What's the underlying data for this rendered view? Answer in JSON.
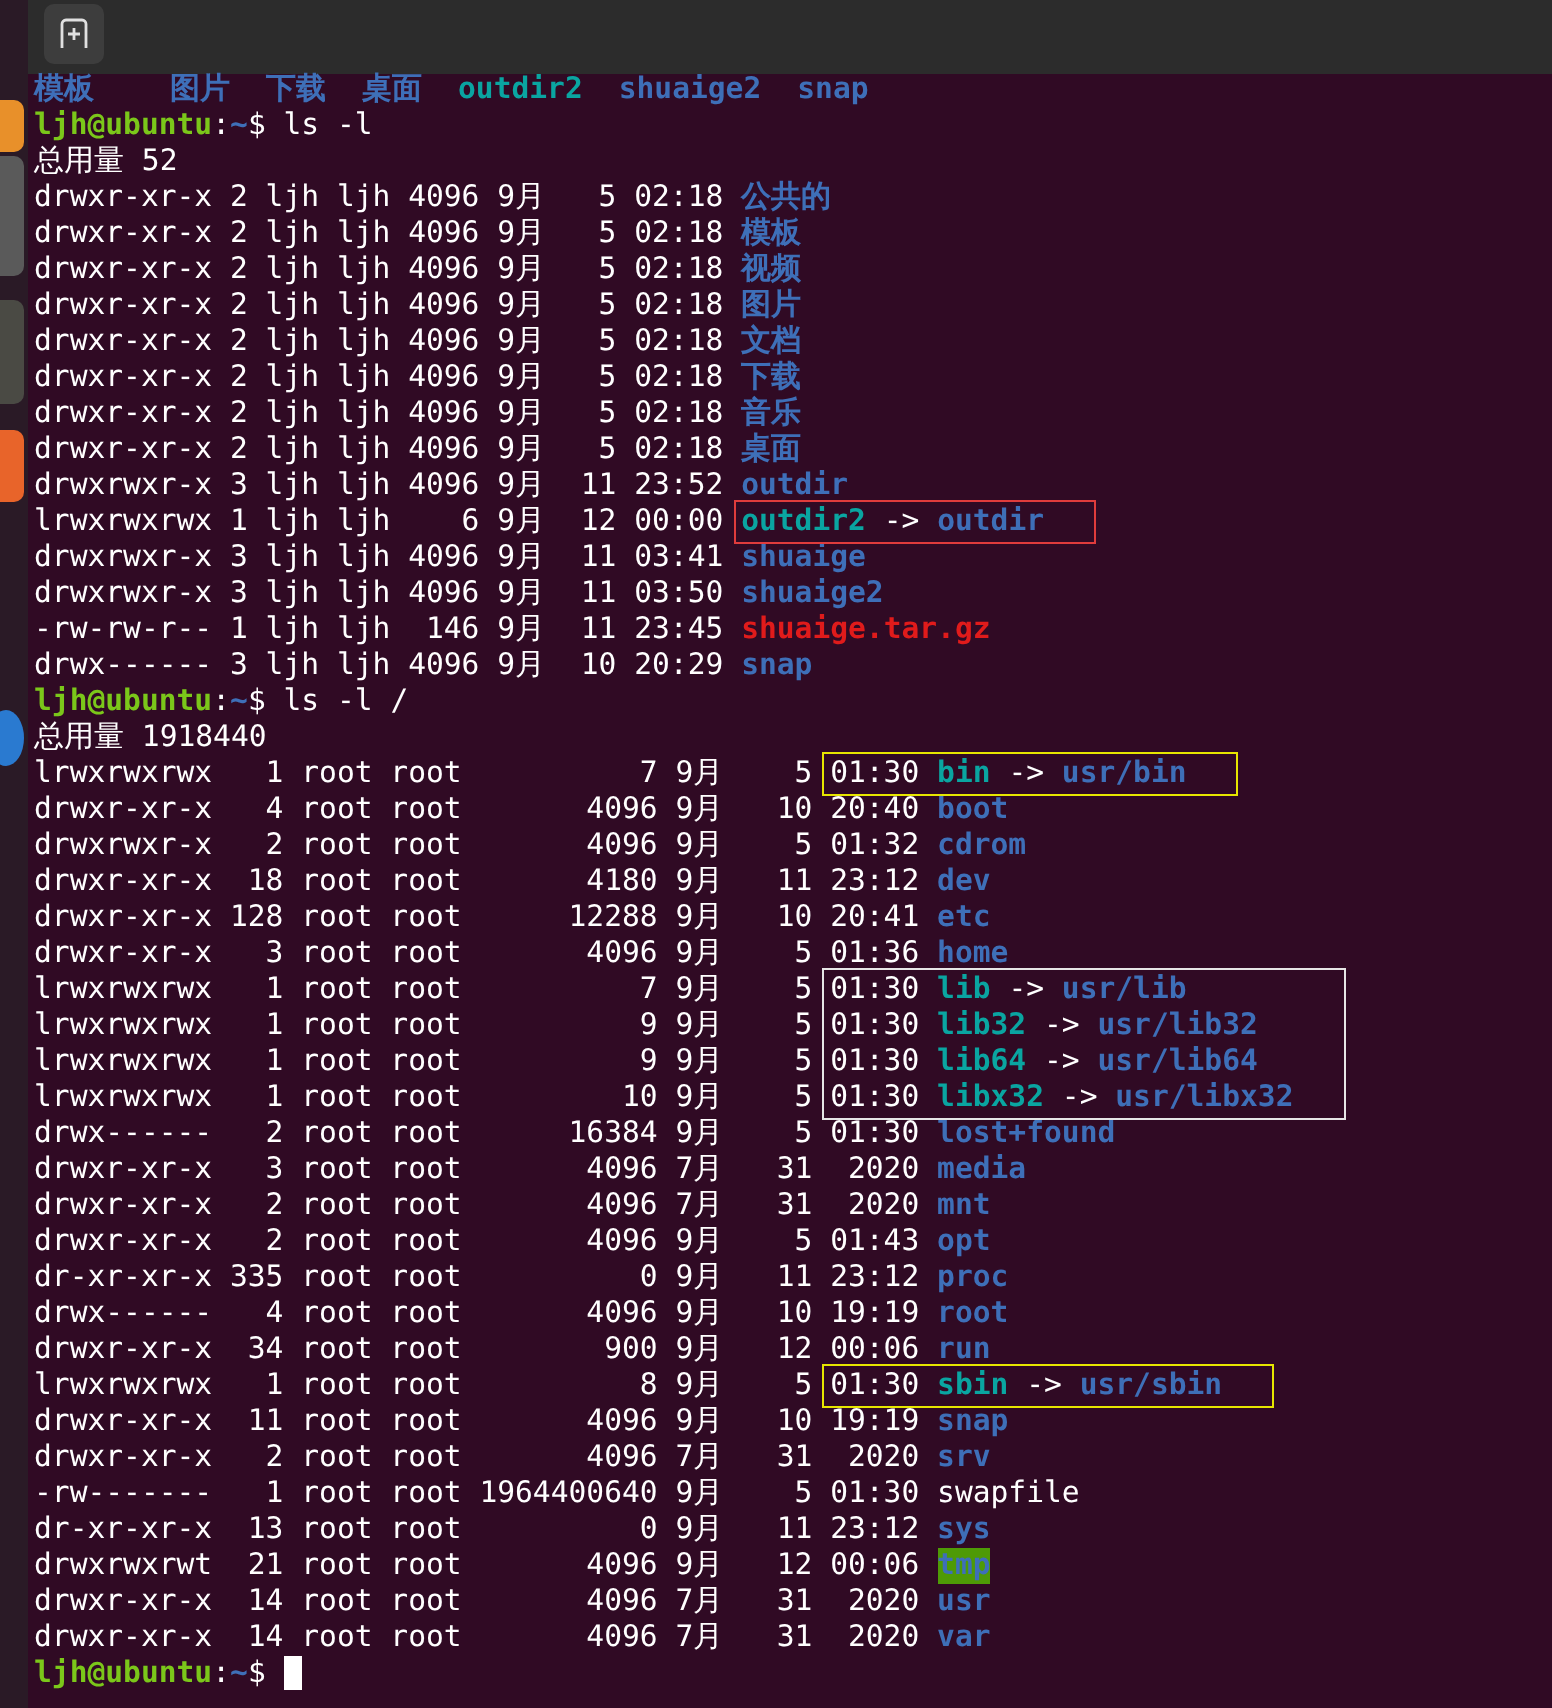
{
  "terminal": {
    "lines": [
      {
        "kind": "names",
        "items": [
          {
            "text": "模板",
            "kind": "dir"
          },
          {
            "text": "图片",
            "kind": "dir"
          },
          {
            "text": "下载",
            "kind": "dir"
          },
          {
            "text": "桌面",
            "kind": "dir"
          },
          {
            "text": "outdir2",
            "kind": "link"
          },
          {
            "text": "shuaige2",
            "kind": "dir"
          },
          {
            "text": "snap",
            "kind": "dir"
          }
        ]
      },
      {
        "kind": "prompt",
        "parts": [
          {
            "text": "ljh@ubuntu",
            "kind": "user"
          },
          {
            "text": ":",
            "kind": "plain"
          },
          {
            "text": "~",
            "kind": "path"
          },
          {
            "text": "$ ls -l",
            "kind": "plain"
          }
        ]
      },
      {
        "kind": "total",
        "text": "总用量 52"
      },
      {
        "kind": "entry",
        "info": "drwxr-xr-x 2 ljh ljh 4096 9月   5",
        "time": "02:18",
        "file": {
          "kind": "dir",
          "name": "公共的"
        }
      },
      {
        "kind": "entry",
        "info": "drwxr-xr-x 2 ljh ljh 4096 9月   5",
        "time": "02:18",
        "file": {
          "kind": "dir",
          "name": "模板"
        }
      },
      {
        "kind": "entry",
        "info": "drwxr-xr-x 2 ljh ljh 4096 9月   5",
        "time": "02:18",
        "file": {
          "kind": "dir",
          "name": "视频"
        }
      },
      {
        "kind": "entry",
        "info": "drwxr-xr-x 2 ljh ljh 4096 9月   5",
        "time": "02:18",
        "file": {
          "kind": "dir",
          "name": "图片"
        }
      },
      {
        "kind": "entry",
        "info": "drwxr-xr-x 2 ljh ljh 4096 9月   5",
        "time": "02:18",
        "file": {
          "kind": "dir",
          "name": "文档"
        }
      },
      {
        "kind": "entry",
        "info": "drwxr-xr-x 2 ljh ljh 4096 9月   5",
        "time": "02:18",
        "file": {
          "kind": "dir",
          "name": "下载"
        }
      },
      {
        "kind": "entry",
        "info": "drwxr-xr-x 2 ljh ljh 4096 9月   5",
        "time": "02:18",
        "file": {
          "kind": "dir",
          "name": "音乐"
        }
      },
      {
        "kind": "entry",
        "info": "drwxr-xr-x 2 ljh ljh 4096 9月   5",
        "time": "02:18",
        "file": {
          "kind": "dir",
          "name": "桌面"
        }
      },
      {
        "kind": "entry",
        "info": "drwxrwxr-x 3 ljh ljh 4096 9月  11",
        "time": "23:52",
        "file": {
          "kind": "dir",
          "name": "outdir"
        }
      },
      {
        "kind": "entry",
        "info": "lrwxrwxrwx 1 ljh ljh    6 9月  12",
        "time": "00:00",
        "file": {
          "kind": "link",
          "name": "outdir2",
          "arrow": "->",
          "target": "outdir"
        },
        "box": {
          "kind": "name",
          "color": "#e03c3c"
        }
      },
      {
        "kind": "entry",
        "info": "drwxrwxr-x 3 ljh ljh 4096 9月  11",
        "time": "03:41",
        "file": {
          "kind": "dir",
          "name": "shuaige"
        }
      },
      {
        "kind": "entry",
        "info": "drwxrwxr-x 3 ljh ljh 4096 9月  11",
        "time": "03:50",
        "file": {
          "kind": "dir",
          "name": "shuaige2"
        }
      },
      {
        "kind": "entry",
        "info": "-rw-rw-r-- 1 ljh ljh  146 9月  11",
        "time": "23:45",
        "file": {
          "kind": "archive",
          "name": "shuaige.tar.gz"
        }
      },
      {
        "kind": "entry",
        "info": "drwx------ 3 ljh ljh 4096 9月  10",
        "time": "20:29",
        "file": {
          "kind": "dir",
          "name": "snap"
        }
      },
      {
        "kind": "prompt",
        "parts": [
          {
            "text": "ljh@ubuntu",
            "kind": "user"
          },
          {
            "text": ":",
            "kind": "plain"
          },
          {
            "text": "~",
            "kind": "path"
          },
          {
            "text": "$ ls -l /",
            "kind": "plain"
          }
        ]
      },
      {
        "kind": "total",
        "text": "总用量 1918440"
      },
      {
        "kind": "entry",
        "info": "lrwxrwxrwx   1 root root          7 9月    5",
        "time": "01:30",
        "file": {
          "kind": "link",
          "name": "bin",
          "arrow": "->",
          "target": "usr/bin"
        },
        "box": {
          "kind": "time",
          "color": "#e6e600"
        }
      },
      {
        "kind": "entry",
        "info": "drwxr-xr-x   4 root root       4096 9月   10",
        "time": "20:40",
        "file": {
          "kind": "dir",
          "name": "boot"
        }
      },
      {
        "kind": "entry",
        "info": "drwxrwxr-x   2 root root       4096 9月    5",
        "time": "01:32",
        "file": {
          "kind": "dir",
          "name": "cdrom"
        }
      },
      {
        "kind": "entry",
        "info": "drwxr-xr-x  18 root root       4180 9月   11",
        "time": "23:12",
        "file": {
          "kind": "dir",
          "name": "dev"
        }
      },
      {
        "kind": "entry",
        "info": "drwxr-xr-x 128 root root      12288 9月   10",
        "time": "20:41",
        "file": {
          "kind": "dir",
          "name": "etc"
        }
      },
      {
        "kind": "entry",
        "info": "drwxr-xr-x   3 root root       4096 9月    5",
        "time": "01:36",
        "file": {
          "kind": "dir",
          "name": "home"
        }
      },
      {
        "kind": "entry",
        "info": "lrwxrwxrwx   1 root root          7 9月    5",
        "time": "01:30",
        "file": {
          "kind": "link",
          "name": "lib",
          "arrow": "->",
          "target": "usr/lib"
        },
        "box": {
          "kind": "time",
          "color": "#e6e6e6"
        }
      },
      {
        "kind": "entry",
        "info": "lrwxrwxrwx   1 root root          9 9月    5",
        "time": "01:30",
        "file": {
          "kind": "link",
          "name": "lib32",
          "arrow": "->",
          "target": "usr/lib32"
        },
        "box": {
          "kind": "time",
          "color": "#e6e6e6"
        }
      },
      {
        "kind": "entry",
        "info": "lrwxrwxrwx   1 root root          9 9月    5",
        "time": "01:30",
        "file": {
          "kind": "link",
          "name": "lib64",
          "arrow": "->",
          "target": "usr/lib64"
        },
        "box": {
          "kind": "time",
          "color": "#e6e6e6"
        }
      },
      {
        "kind": "entry",
        "info": "lrwxrwxrwx   1 root root         10 9月    5",
        "time": "01:30",
        "file": {
          "kind": "link",
          "name": "libx32",
          "arrow": "->",
          "target": "usr/libx32"
        },
        "box": {
          "kind": "time",
          "color": "#e6e6e6"
        }
      },
      {
        "kind": "entry",
        "info": "drwx------   2 root root      16384 9月    5",
        "time": "01:30",
        "file": {
          "kind": "dir",
          "name": "lost+found"
        }
      },
      {
        "kind": "entry",
        "info": "drwxr-xr-x   3 root root       4096 7月   31",
        "time": " 2020",
        "file": {
          "kind": "dir",
          "name": "media"
        }
      },
      {
        "kind": "entry",
        "info": "drwxr-xr-x   2 root root       4096 7月   31",
        "time": " 2020",
        "file": {
          "kind": "dir",
          "name": "mnt"
        }
      },
      {
        "kind": "entry",
        "info": "drwxr-xr-x   2 root root       4096 9月    5",
        "time": "01:43",
        "file": {
          "kind": "dir",
          "name": "opt"
        }
      },
      {
        "kind": "entry",
        "info": "dr-xr-xr-x 335 root root          0 9月   11",
        "time": "23:12",
        "file": {
          "kind": "dir",
          "name": "proc"
        }
      },
      {
        "kind": "entry",
        "info": "drwx------   4 root root       4096 9月   10",
        "time": "19:19",
        "file": {
          "kind": "dir",
          "name": "root"
        }
      },
      {
        "kind": "entry",
        "info": "drwxr-xr-x  34 root root        900 9月   12",
        "time": "00:06",
        "file": {
          "kind": "dir",
          "name": "run"
        }
      },
      {
        "kind": "entry",
        "info": "lrwxrwxrwx   1 root root          8 9月    5",
        "time": "01:30",
        "file": {
          "kind": "link",
          "name": "sbin",
          "arrow": "->",
          "target": "usr/sbin"
        },
        "box": {
          "kind": "time",
          "color": "#e6e600"
        }
      },
      {
        "kind": "entry",
        "info": "drwxr-xr-x  11 root root       4096 9月   10",
        "time": "19:19",
        "file": {
          "kind": "dir",
          "name": "snap"
        }
      },
      {
        "kind": "entry",
        "info": "drwxr-xr-x   2 root root       4096 7月   31",
        "time": " 2020",
        "file": {
          "kind": "dir",
          "name": "srv"
        }
      },
      {
        "kind": "entry",
        "info": "-rw-------   1 root root 1964400640 9月    5",
        "time": "01:30",
        "file": {
          "kind": "file",
          "name": "swapfile"
        }
      },
      {
        "kind": "entry",
        "info": "dr-xr-xr-x  13 root root          0 9月   11",
        "time": "23:12",
        "file": {
          "kind": "dir",
          "name": "sys"
        }
      },
      {
        "kind": "entry",
        "info": "drwxrwxrwt  21 root root       4096 9月   12",
        "time": "00:06",
        "file": {
          "kind": "sticky",
          "name": "tmp"
        }
      },
      {
        "kind": "entry",
        "info": "drwxr-xr-x  14 root root       4096 7月   31",
        "time": " 2020",
        "file": {
          "kind": "dir",
          "name": "usr"
        }
      },
      {
        "kind": "entry",
        "info": "drwxr-xr-x  14 root root       4096 7月   31",
        "time": " 2020",
        "file": {
          "kind": "dir",
          "name": "var"
        }
      },
      {
        "kind": "prompt",
        "parts": [
          {
            "text": "ljh@ubuntu",
            "kind": "user"
          },
          {
            "text": ":",
            "kind": "plain"
          },
          {
            "text": "~",
            "kind": "path"
          },
          {
            "text": "$ ",
            "kind": "plain"
          }
        ],
        "cursor": true
      }
    ]
  }
}
